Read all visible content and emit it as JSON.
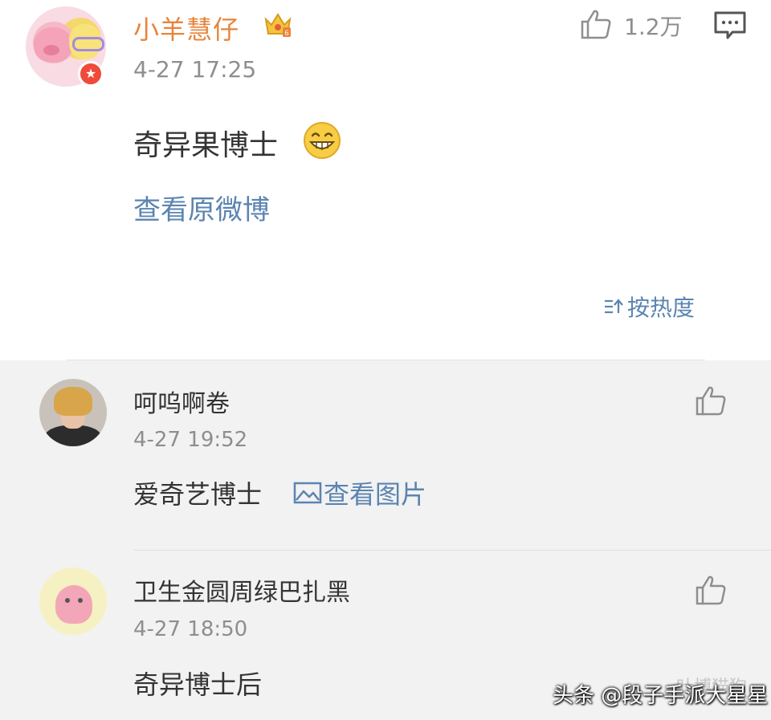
{
  "post": {
    "author_name": "小羊慧仔",
    "timestamp": "4-27 17:25",
    "like_count": "1.2万",
    "text": "奇异果博士",
    "emoji": "grin-emoji",
    "view_original_label": "查看原微博",
    "badge_icon": "verified-star-icon",
    "crown_icon": "vip-crown-icon"
  },
  "sort": {
    "label": "按热度",
    "icon": "sort-icon"
  },
  "comments": [
    {
      "name": "呵呜啊卷",
      "time": "4-27 19:52",
      "text": "爱奇艺博士",
      "attachment_label": "查看图片",
      "attachment_icon": "image-icon",
      "like_icon": "thumbs-up-icon"
    },
    {
      "name": "卫生金圆周绿巴扎黑",
      "time": "4-27 18:50",
      "text": "奇异博士后",
      "like_icon": "thumbs-up-icon"
    }
  ],
  "watermark": {
    "main": "头条 @段子手派大星星",
    "faint": "叶博猫狗"
  },
  "colors": {
    "author_orange": "#e8843a",
    "link_blue": "#5b84b1",
    "meta_gray": "#8e8e8e",
    "comment_bg": "#f2f2f2"
  }
}
